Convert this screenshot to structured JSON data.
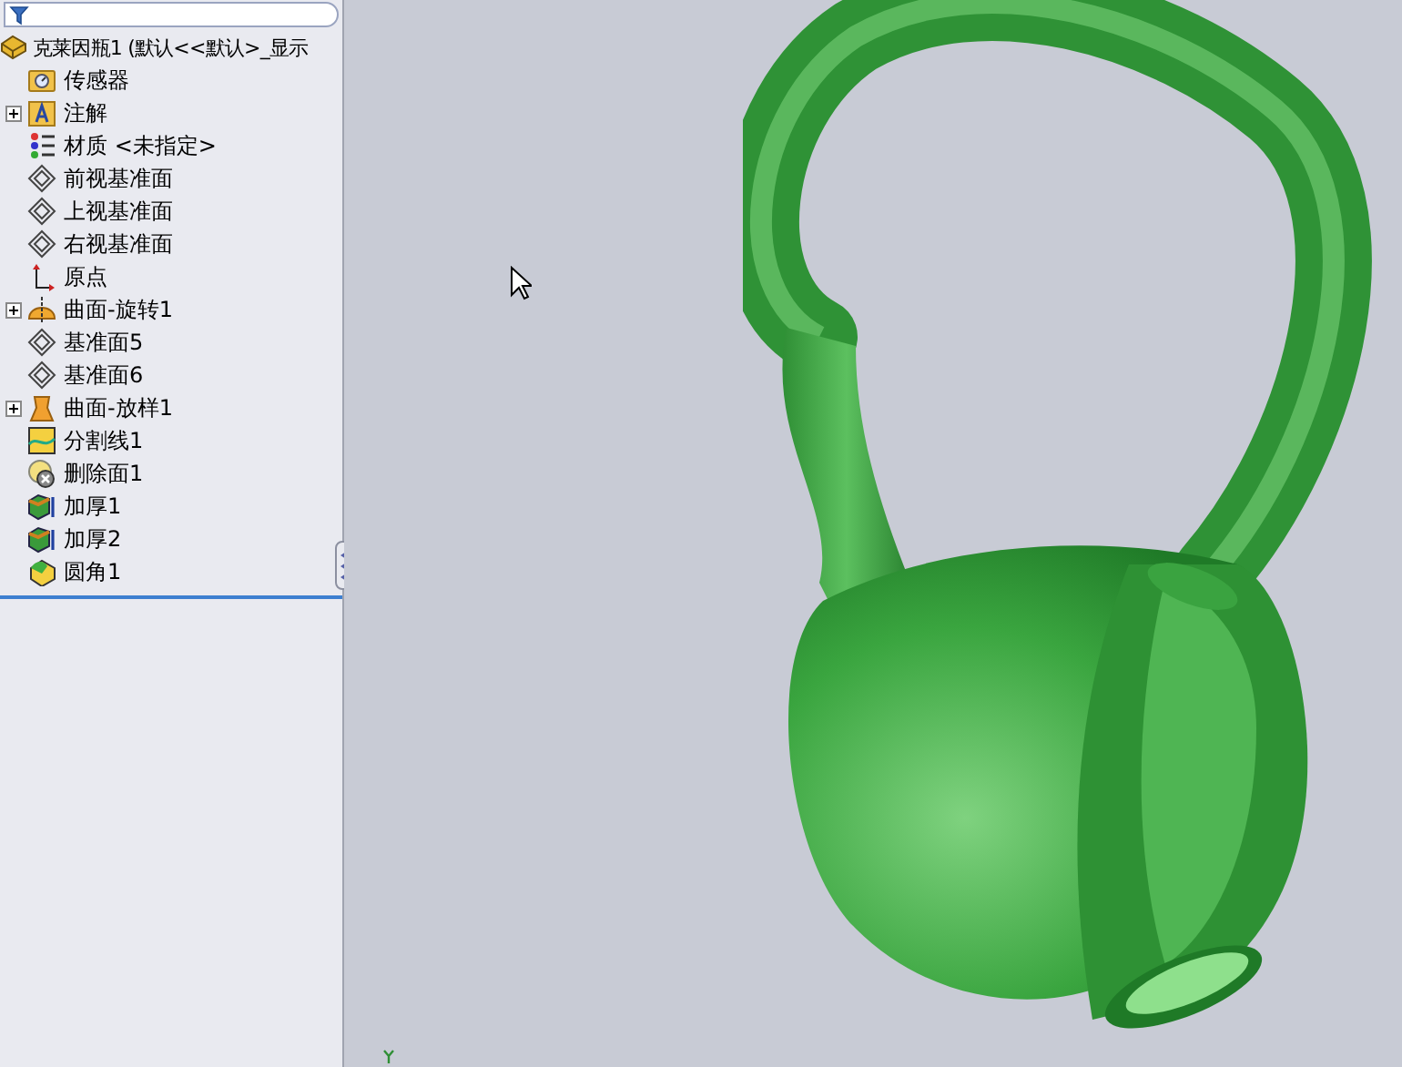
{
  "tree": {
    "label": "克莱因瓶1 (默认<<默认>_显示",
    "kind": "part",
    "children": [
      {
        "label": "传感器",
        "kind": "sensor",
        "expandable": false
      },
      {
        "label": "注解",
        "kind": "annotation",
        "expandable": true
      },
      {
        "label": "材质 <未指定>",
        "kind": "material",
        "expandable": false
      },
      {
        "label": "前视基准面",
        "kind": "plane",
        "expandable": false
      },
      {
        "label": "上视基准面",
        "kind": "plane",
        "expandable": false
      },
      {
        "label": "右视基准面",
        "kind": "plane",
        "expandable": false
      },
      {
        "label": "原点",
        "kind": "origin",
        "expandable": false
      },
      {
        "label": "曲面-旋转1",
        "kind": "revolve",
        "expandable": true
      },
      {
        "label": "基准面5",
        "kind": "plane",
        "expandable": false
      },
      {
        "label": "基准面6",
        "kind": "plane",
        "expandable": false
      },
      {
        "label": "曲面-放样1",
        "kind": "loft",
        "expandable": true
      },
      {
        "label": "分割线1",
        "kind": "split",
        "expandable": false
      },
      {
        "label": "删除面1",
        "kind": "delete",
        "expandable": false
      },
      {
        "label": "加厚1",
        "kind": "thicken",
        "expandable": false
      },
      {
        "label": "加厚2",
        "kind": "thicken",
        "expandable": false
      },
      {
        "label": "圆角1",
        "kind": "fillet",
        "expandable": false
      }
    ]
  }
}
